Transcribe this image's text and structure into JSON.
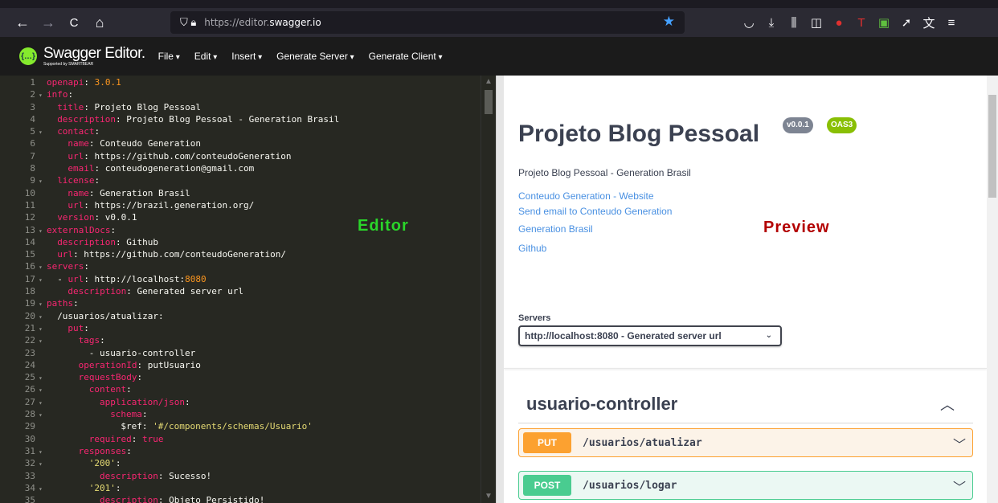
{
  "browser": {
    "url_prefix": "https://editor.",
    "url_domain": "swagger.io",
    "back": "←",
    "forward": "→",
    "reload": "C",
    "home": "⌂",
    "star": "★",
    "toolbar_icons": [
      "pocket-icon",
      "download-icon",
      "library-icon",
      "sidebar-icon",
      "extension-badge-icon",
      "text-icon",
      "extension-icon",
      "extension2-icon",
      "translate-icon",
      "menu-icon"
    ]
  },
  "swagger": {
    "brand": "Swagger Editor.",
    "sub": "Supported by SMARTBEAR",
    "logo_text": "{…}",
    "menu": [
      "File",
      "Edit",
      "Insert",
      "Generate Server",
      "Generate Client"
    ]
  },
  "editor": {
    "label": "Editor",
    "lines": [
      {
        "n": "1",
        "f": false,
        "i": 0,
        "t": [
          [
            "k",
            "openapi"
          ],
          [
            "c",
            ": "
          ],
          [
            "n",
            "3.0.1"
          ]
        ]
      },
      {
        "n": "2",
        "f": true,
        "i": 0,
        "t": [
          [
            "k",
            "info"
          ],
          [
            "c",
            ":"
          ]
        ]
      },
      {
        "n": "3",
        "f": false,
        "i": 2,
        "t": [
          [
            "k",
            "title"
          ],
          [
            "c",
            ": Projeto Blog Pessoal"
          ]
        ]
      },
      {
        "n": "4",
        "f": false,
        "i": 2,
        "t": [
          [
            "k",
            "description"
          ],
          [
            "c",
            ": Projeto Blog Pessoal - Generation Brasil"
          ]
        ]
      },
      {
        "n": "5",
        "f": true,
        "i": 2,
        "t": [
          [
            "k",
            "contact"
          ],
          [
            "c",
            ":"
          ]
        ]
      },
      {
        "n": "6",
        "f": false,
        "i": 4,
        "t": [
          [
            "k",
            "name"
          ],
          [
            "c",
            ": Conteudo Generation"
          ]
        ]
      },
      {
        "n": "7",
        "f": false,
        "i": 4,
        "t": [
          [
            "k",
            "url"
          ],
          [
            "c",
            ": https://github.com/conteudoGeneration"
          ]
        ]
      },
      {
        "n": "8",
        "f": false,
        "i": 4,
        "t": [
          [
            "k",
            "email"
          ],
          [
            "c",
            ": conteudogeneration@gmail.com"
          ]
        ]
      },
      {
        "n": "9",
        "f": true,
        "i": 2,
        "t": [
          [
            "k",
            "license"
          ],
          [
            "c",
            ":"
          ]
        ]
      },
      {
        "n": "10",
        "f": false,
        "i": 4,
        "t": [
          [
            "k",
            "name"
          ],
          [
            "c",
            ": Generation Brasil"
          ]
        ]
      },
      {
        "n": "11",
        "f": false,
        "i": 4,
        "t": [
          [
            "k",
            "url"
          ],
          [
            "c",
            ": https://brazil.generation.org/"
          ]
        ]
      },
      {
        "n": "12",
        "f": false,
        "i": 2,
        "t": [
          [
            "k",
            "version"
          ],
          [
            "c",
            ": v0.0.1"
          ]
        ]
      },
      {
        "n": "13",
        "f": true,
        "i": 0,
        "t": [
          [
            "k",
            "externalDocs"
          ],
          [
            "c",
            ":"
          ]
        ]
      },
      {
        "n": "14",
        "f": false,
        "i": 2,
        "t": [
          [
            "k",
            "description"
          ],
          [
            "c",
            ": Github"
          ]
        ]
      },
      {
        "n": "15",
        "f": false,
        "i": 2,
        "t": [
          [
            "k",
            "url"
          ],
          [
            "c",
            ": https://github.com/conteudoGeneration/"
          ]
        ]
      },
      {
        "n": "16",
        "f": true,
        "i": 0,
        "t": [
          [
            "k",
            "servers"
          ],
          [
            "c",
            ":"
          ]
        ]
      },
      {
        "n": "17",
        "f": true,
        "i": 2,
        "t": [
          [
            "c",
            "- "
          ],
          [
            "k",
            "url"
          ],
          [
            "c",
            ": http://localhost:"
          ],
          [
            "n",
            "8080"
          ]
        ]
      },
      {
        "n": "18",
        "f": false,
        "i": 4,
        "t": [
          [
            "k",
            "description"
          ],
          [
            "c",
            ": Generated server url"
          ]
        ]
      },
      {
        "n": "19",
        "f": true,
        "i": 0,
        "t": [
          [
            "k",
            "paths"
          ],
          [
            "c",
            ":"
          ]
        ]
      },
      {
        "n": "20",
        "f": true,
        "i": 2,
        "t": [
          [
            "c",
            "/usuarios/atualizar:"
          ]
        ]
      },
      {
        "n": "21",
        "f": true,
        "i": 4,
        "t": [
          [
            "k",
            "put"
          ],
          [
            "c",
            ":"
          ]
        ]
      },
      {
        "n": "22",
        "f": true,
        "i": 6,
        "t": [
          [
            "k",
            "tags"
          ],
          [
            "c",
            ":"
          ]
        ]
      },
      {
        "n": "23",
        "f": false,
        "i": 8,
        "t": [
          [
            "c",
            "- usuario-controller"
          ]
        ]
      },
      {
        "n": "24",
        "f": false,
        "i": 6,
        "t": [
          [
            "k",
            "operationId"
          ],
          [
            "c",
            ": putUsuario"
          ]
        ]
      },
      {
        "n": "25",
        "f": true,
        "i": 6,
        "t": [
          [
            "k",
            "requestBody"
          ],
          [
            "c",
            ":"
          ]
        ]
      },
      {
        "n": "26",
        "f": true,
        "i": 8,
        "t": [
          [
            "k",
            "content"
          ],
          [
            "c",
            ":"
          ]
        ]
      },
      {
        "n": "27",
        "f": true,
        "i": 10,
        "t": [
          [
            "k",
            "application/json"
          ],
          [
            "c",
            ":"
          ]
        ]
      },
      {
        "n": "28",
        "f": true,
        "i": 12,
        "t": [
          [
            "k",
            "schema"
          ],
          [
            "c",
            ":"
          ]
        ]
      },
      {
        "n": "29",
        "f": false,
        "i": 14,
        "t": [
          [
            "c",
            "$ref: "
          ],
          [
            "s",
            "'#/components/schemas/Usuario'"
          ]
        ]
      },
      {
        "n": "30",
        "f": false,
        "i": 8,
        "t": [
          [
            "k",
            "required"
          ],
          [
            "c",
            ": "
          ],
          [
            "k",
            "true"
          ]
        ]
      },
      {
        "n": "31",
        "f": true,
        "i": 6,
        "t": [
          [
            "k",
            "responses"
          ],
          [
            "c",
            ":"
          ]
        ]
      },
      {
        "n": "32",
        "f": true,
        "i": 8,
        "t": [
          [
            "s",
            "'200'"
          ],
          [
            "c",
            ":"
          ]
        ]
      },
      {
        "n": "33",
        "f": false,
        "i": 10,
        "t": [
          [
            "k",
            "description"
          ],
          [
            "c",
            ": Sucesso!"
          ]
        ]
      },
      {
        "n": "34",
        "f": true,
        "i": 8,
        "t": [
          [
            "s",
            "'201'"
          ],
          [
            "c",
            ":"
          ]
        ]
      },
      {
        "n": "35",
        "f": false,
        "i": 10,
        "t": [
          [
            "k",
            "description"
          ],
          [
            "c",
            ": Objeto Persistido!"
          ]
        ]
      }
    ]
  },
  "preview": {
    "label": "Preview",
    "title": "Projeto Blog Pessoal",
    "version_badge": "v0.0.1",
    "oas_badge": "OAS3",
    "description": "Projeto Blog Pessoal - Generation Brasil",
    "links": [
      "Conteudo Generation - Website",
      "Send email to Conteudo Generation",
      "Generation Brasil",
      "Github"
    ],
    "servers_label": "Servers",
    "server_selected": "http://localhost:8080 - Generated server url",
    "tag": "usuario-controller",
    "operations": [
      {
        "method": "PUT",
        "path": "/usuarios/atualizar"
      },
      {
        "method": "POST",
        "path": "/usuarios/logar"
      }
    ]
  }
}
